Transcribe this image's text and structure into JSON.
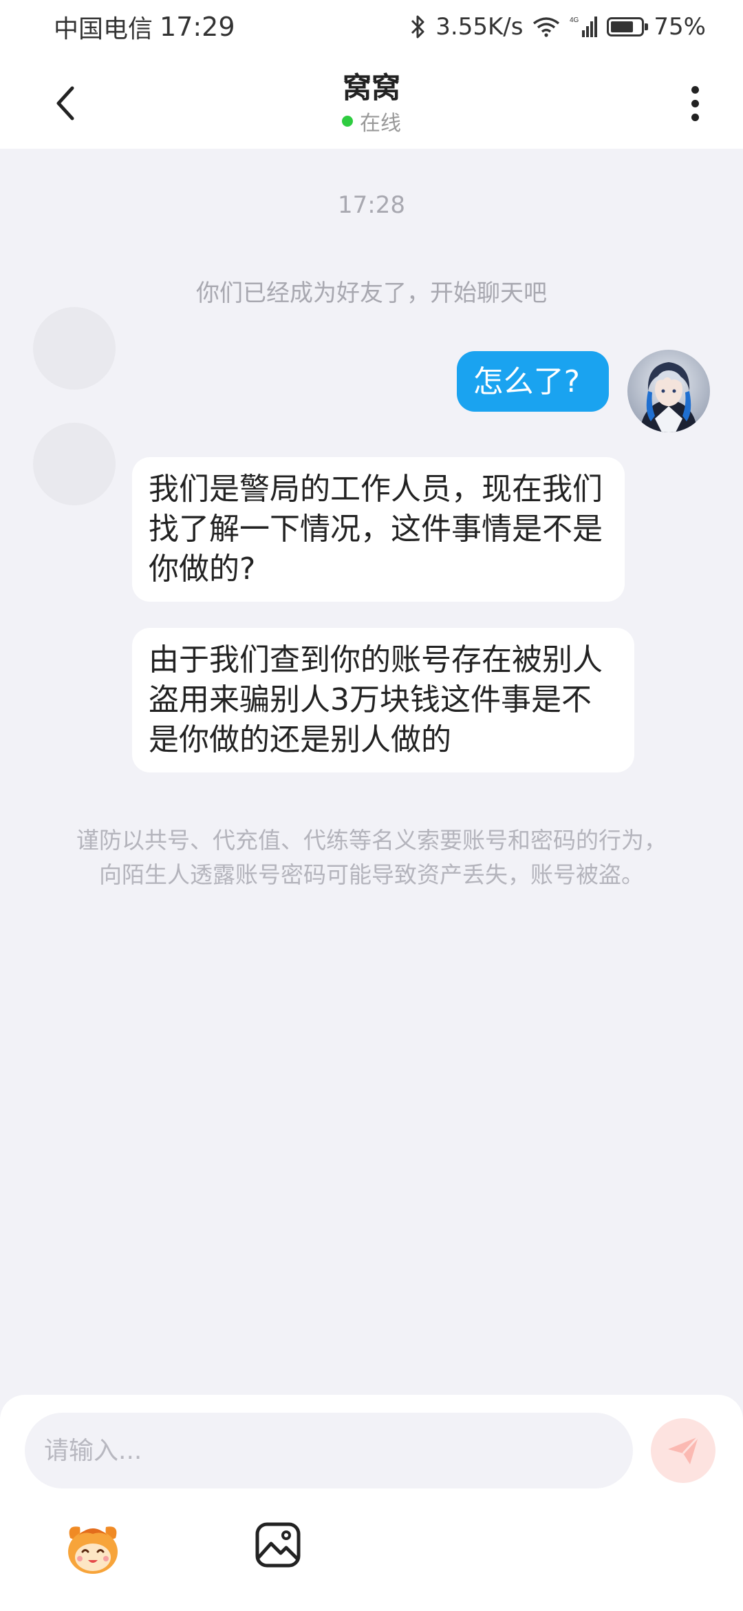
{
  "status_bar": {
    "carrier": "中国电信",
    "time": "17:29",
    "network_speed": "3.55K/s",
    "network_type": "4G",
    "battery_percent": "75%",
    "battery_level": 0.75,
    "icons": [
      "bluetooth-icon",
      "wifi-icon",
      "signal-icon",
      "battery-icon"
    ]
  },
  "header": {
    "title": "窝窝",
    "status": "在线",
    "status_color": "#2ecc40",
    "icons": [
      "back-arrow-icon",
      "more-vertical-icon"
    ]
  },
  "chat": {
    "timestamp": "17:28",
    "system_notice": "你们已经成为好友了，开始聊天吧",
    "messages": [
      {
        "direction": "outgoing",
        "text": "怎么了?"
      },
      {
        "direction": "incoming",
        "text": "我们是警局的工作人员，现在我们找了解一下情况，这件事情是不是你做的?"
      },
      {
        "direction": "incoming",
        "text": "由于我们查到你的账号存在被别人盗用来骗别人3万块钱这件事是不是你做的还是别人做的"
      }
    ],
    "safety_tip": "谨防以共号、代充值、代练等名义索要账号和密码的行为，向陌生人透露账号密码可能导致资产丢失，账号被盗。",
    "outgoing_bubble_color": "#1aa3f0"
  },
  "input_bar": {
    "placeholder": "请输入...",
    "icons": [
      "send-icon",
      "emoji-mascot-icon",
      "image-icon"
    ]
  }
}
